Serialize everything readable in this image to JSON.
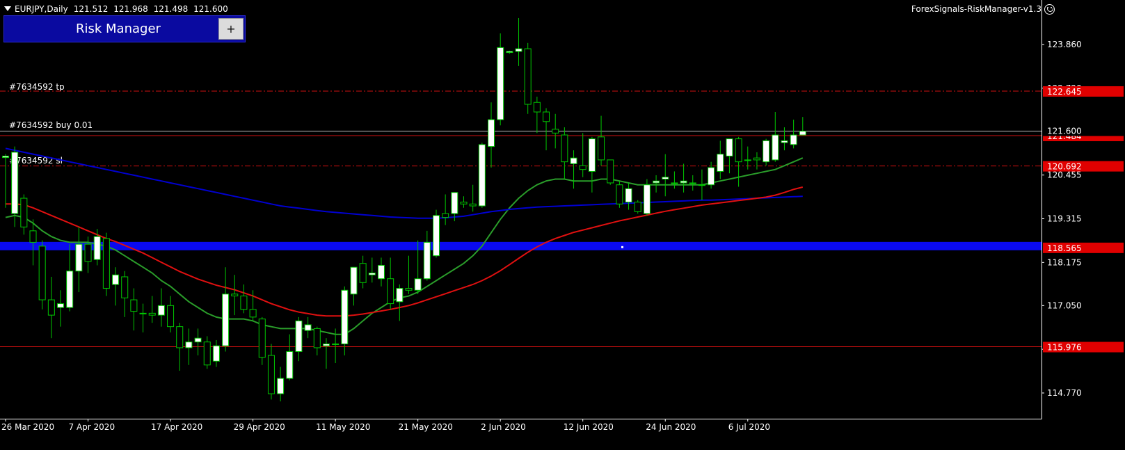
{
  "header": {
    "symbol": "EURJPY,Daily",
    "open": "121.512",
    "high": "121.968",
    "low": "121.498",
    "close": "121.600",
    "ea_name": "ForexSignals-RiskManager-v1.3",
    "ea_icon": "smile-icon"
  },
  "risk_manager": {
    "title": "Risk Manager",
    "plus_label": "+"
  },
  "order_labels": {
    "tp": "#7634592 tp",
    "buy": "#7634592 buy 0.01",
    "sl": "#7634592 sl"
  },
  "colors": {
    "background": "#000000",
    "bull_candle": "#ffffff",
    "bear_candle": "#000000",
    "wick": "#00c800",
    "ma_fast": "#2a9d2a",
    "ma_mid": "#0000d0",
    "ma_slow": "#e01010",
    "level_line": "#d01010",
    "blue_band": "#0a0af0",
    "price_tag": "#e00000"
  },
  "chart_data": {
    "type": "candlestick",
    "symbol": "EURJPY",
    "timeframe": "Daily",
    "y_axis": {
      "range": [
        114.0,
        124.8
      ],
      "ticks": [
        "123.860",
        "122.720",
        "121.600",
        "120.455",
        "119.315",
        "118.175",
        "117.050",
        "115.910",
        "114.770"
      ]
    },
    "x_axis": {
      "ticks": [
        "26 Mar 2020",
        "7 Apr 2020",
        "17 Apr 2020",
        "29 Apr 2020",
        "11 May 2020",
        "21 May 2020",
        "2 Jun 2020",
        "12 Jun 2020",
        "24 Jun 2020",
        "6 Jul 2020"
      ]
    },
    "grid": false,
    "candles": [
      {
        "o": 120.91,
        "h": 121.0,
        "l": 119.6,
        "c": 120.95
      },
      {
        "o": 119.45,
        "h": 121.2,
        "l": 119.1,
        "c": 121.05
      },
      {
        "o": 119.85,
        "h": 119.95,
        "l": 118.9,
        "c": 119.1
      },
      {
        "o": 119.0,
        "h": 119.3,
        "l": 118.1,
        "c": 118.7
      },
      {
        "o": 118.6,
        "h": 118.75,
        "l": 116.95,
        "c": 117.2
      },
      {
        "o": 117.2,
        "h": 117.8,
        "l": 116.2,
        "c": 116.8
      },
      {
        "o": 117.0,
        "h": 117.45,
        "l": 116.5,
        "c": 117.1
      },
      {
        "o": 117.0,
        "h": 118.65,
        "l": 116.9,
        "c": 117.95
      },
      {
        "o": 117.95,
        "h": 119.1,
        "l": 117.4,
        "c": 118.65
      },
      {
        "o": 118.65,
        "h": 118.85,
        "l": 117.9,
        "c": 118.2
      },
      {
        "o": 118.25,
        "h": 119.05,
        "l": 118.1,
        "c": 118.85
      },
      {
        "o": 118.8,
        "h": 118.95,
        "l": 117.3,
        "c": 117.5
      },
      {
        "o": 117.6,
        "h": 118.05,
        "l": 117.05,
        "c": 117.85
      },
      {
        "o": 117.8,
        "h": 117.95,
        "l": 116.75,
        "c": 117.25
      },
      {
        "o": 117.2,
        "h": 117.5,
        "l": 116.4,
        "c": 116.9
      },
      {
        "o": 116.85,
        "h": 117.1,
        "l": 116.35,
        "c": 116.85
      },
      {
        "o": 116.85,
        "h": 117.3,
        "l": 116.6,
        "c": 116.8
      },
      {
        "o": 116.8,
        "h": 117.5,
        "l": 116.5,
        "c": 117.05
      },
      {
        "o": 117.05,
        "h": 117.3,
        "l": 116.35,
        "c": 116.5
      },
      {
        "o": 116.5,
        "h": 116.6,
        "l": 115.35,
        "c": 115.95
      },
      {
        "o": 115.95,
        "h": 116.45,
        "l": 115.5,
        "c": 116.1
      },
      {
        "o": 116.1,
        "h": 116.45,
        "l": 115.75,
        "c": 116.2
      },
      {
        "o": 116.1,
        "h": 116.25,
        "l": 115.4,
        "c": 115.5
      },
      {
        "o": 115.6,
        "h": 116.15,
        "l": 115.45,
        "c": 116.0
      },
      {
        "o": 116.0,
        "h": 118.05,
        "l": 115.85,
        "c": 117.35
      },
      {
        "o": 117.35,
        "h": 117.85,
        "l": 116.8,
        "c": 117.3
      },
      {
        "o": 117.3,
        "h": 117.6,
        "l": 116.85,
        "c": 116.95
      },
      {
        "o": 116.95,
        "h": 117.45,
        "l": 116.65,
        "c": 116.75
      },
      {
        "o": 116.7,
        "h": 116.75,
        "l": 115.5,
        "c": 115.7
      },
      {
        "o": 115.75,
        "h": 116.05,
        "l": 114.6,
        "c": 114.75
      },
      {
        "o": 114.75,
        "h": 115.45,
        "l": 114.55,
        "c": 115.15
      },
      {
        "o": 115.15,
        "h": 116.3,
        "l": 115.1,
        "c": 115.85
      },
      {
        "o": 115.85,
        "h": 116.75,
        "l": 115.6,
        "c": 116.65
      },
      {
        "o": 116.4,
        "h": 116.75,
        "l": 116.2,
        "c": 116.55
      },
      {
        "o": 116.45,
        "h": 116.5,
        "l": 115.75,
        "c": 115.95
      },
      {
        "o": 116.0,
        "h": 116.2,
        "l": 115.4,
        "c": 116.05
      },
      {
        "o": 116.05,
        "h": 116.45,
        "l": 115.55,
        "c": 116.05
      },
      {
        "o": 116.05,
        "h": 117.55,
        "l": 115.75,
        "c": 117.45
      },
      {
        "o": 117.35,
        "h": 118.05,
        "l": 117.05,
        "c": 118.05
      },
      {
        "o": 118.15,
        "h": 118.35,
        "l": 117.5,
        "c": 117.65
      },
      {
        "o": 117.85,
        "h": 118.3,
        "l": 117.65,
        "c": 117.9
      },
      {
        "o": 117.75,
        "h": 118.3,
        "l": 117.55,
        "c": 118.1
      },
      {
        "o": 117.75,
        "h": 118.3,
        "l": 116.95,
        "c": 117.1
      },
      {
        "o": 117.15,
        "h": 117.6,
        "l": 116.65,
        "c": 117.5
      },
      {
        "o": 117.5,
        "h": 118.35,
        "l": 117.35,
        "c": 117.45
      },
      {
        "o": 117.45,
        "h": 118.75,
        "l": 117.35,
        "c": 117.75
      },
      {
        "o": 117.75,
        "h": 119.0,
        "l": 117.7,
        "c": 118.7
      },
      {
        "o": 118.35,
        "h": 119.55,
        "l": 118.3,
        "c": 119.4
      },
      {
        "o": 119.45,
        "h": 119.95,
        "l": 119.15,
        "c": 119.35
      },
      {
        "o": 119.45,
        "h": 120.0,
        "l": 119.25,
        "c": 120.0
      },
      {
        "o": 119.75,
        "h": 119.9,
        "l": 119.6,
        "c": 119.7
      },
      {
        "o": 119.7,
        "h": 120.2,
        "l": 119.5,
        "c": 119.65
      },
      {
        "o": 119.65,
        "h": 121.3,
        "l": 119.6,
        "c": 121.25
      },
      {
        "o": 121.2,
        "h": 122.35,
        "l": 120.65,
        "c": 121.9
      },
      {
        "o": 121.9,
        "h": 124.15,
        "l": 121.75,
        "c": 123.78
      },
      {
        "o": 123.65,
        "h": 123.7,
        "l": 123.62,
        "c": 123.68
      },
      {
        "o": 123.68,
        "h": 124.55,
        "l": 123.3,
        "c": 123.75
      },
      {
        "o": 123.75,
        "h": 123.9,
        "l": 122.05,
        "c": 122.3
      },
      {
        "o": 122.35,
        "h": 122.5,
        "l": 121.55,
        "c": 122.1
      },
      {
        "o": 122.1,
        "h": 122.2,
        "l": 121.1,
        "c": 121.85
      },
      {
        "o": 121.65,
        "h": 122.05,
        "l": 121.15,
        "c": 121.55
      },
      {
        "o": 121.5,
        "h": 121.7,
        "l": 120.35,
        "c": 120.8
      },
      {
        "o": 120.75,
        "h": 121.1,
        "l": 120.1,
        "c": 120.9
      },
      {
        "o": 120.7,
        "h": 121.55,
        "l": 120.4,
        "c": 120.6
      },
      {
        "o": 120.55,
        "h": 121.45,
        "l": 120.0,
        "c": 121.4
      },
      {
        "o": 121.45,
        "h": 122.0,
        "l": 120.7,
        "c": 120.85
      },
      {
        "o": 120.85,
        "h": 120.85,
        "l": 120.2,
        "c": 120.25
      },
      {
        "o": 120.2,
        "h": 120.3,
        "l": 119.6,
        "c": 119.7
      },
      {
        "o": 119.75,
        "h": 120.25,
        "l": 119.55,
        "c": 120.1
      },
      {
        "o": 119.75,
        "h": 119.8,
        "l": 119.45,
        "c": 119.5
      },
      {
        "o": 119.45,
        "h": 120.35,
        "l": 119.4,
        "c": 120.2
      },
      {
        "o": 120.25,
        "h": 120.45,
        "l": 120.0,
        "c": 120.3
      },
      {
        "o": 120.35,
        "h": 121.0,
        "l": 119.9,
        "c": 120.4
      },
      {
        "o": 120.25,
        "h": 120.55,
        "l": 120.1,
        "c": 120.25
      },
      {
        "o": 120.25,
        "h": 120.75,
        "l": 120.0,
        "c": 120.3
      },
      {
        "o": 120.25,
        "h": 120.45,
        "l": 120.05,
        "c": 120.25
      },
      {
        "o": 120.2,
        "h": 120.6,
        "l": 119.8,
        "c": 120.2
      },
      {
        "o": 120.2,
        "h": 120.8,
        "l": 120.1,
        "c": 120.65
      },
      {
        "o": 120.55,
        "h": 121.35,
        "l": 120.35,
        "c": 121.0
      },
      {
        "o": 120.95,
        "h": 121.4,
        "l": 120.5,
        "c": 121.4
      },
      {
        "o": 121.4,
        "h": 121.45,
        "l": 120.15,
        "c": 120.8
      },
      {
        "o": 120.85,
        "h": 121.2,
        "l": 120.6,
        "c": 120.85
      },
      {
        "o": 120.9,
        "h": 121.05,
        "l": 120.6,
        "c": 120.85
      },
      {
        "o": 120.8,
        "h": 121.4,
        "l": 120.7,
        "c": 121.35
      },
      {
        "o": 120.85,
        "h": 122.1,
        "l": 120.8,
        "c": 121.5
      },
      {
        "o": 121.3,
        "h": 121.7,
        "l": 121.1,
        "c": 121.35
      },
      {
        "o": 121.25,
        "h": 121.9,
        "l": 121.15,
        "c": 121.5
      },
      {
        "o": 121.5,
        "h": 121.97,
        "l": 121.49,
        "c": 121.6
      }
    ],
    "moving_averages": [
      {
        "color": "green",
        "values": [
          119.35,
          119.4,
          119.35,
          119.2,
          119.0,
          118.85,
          118.75,
          118.7,
          118.7,
          118.7,
          118.65,
          118.6,
          118.5,
          118.35,
          118.2,
          118.05,
          117.9,
          117.7,
          117.55,
          117.35,
          117.15,
          117.0,
          116.85,
          116.75,
          116.7,
          116.7,
          116.7,
          116.65,
          116.55,
          116.5,
          116.45,
          116.45,
          116.45,
          116.45,
          116.4,
          116.35,
          116.3,
          116.3,
          116.45,
          116.65,
          116.85,
          117.0,
          117.15,
          117.25,
          117.3,
          117.4,
          117.55,
          117.7,
          117.85,
          118.0,
          118.15,
          118.35,
          118.6,
          118.95,
          119.3,
          119.6,
          119.85,
          120.05,
          120.2,
          120.3,
          120.35,
          120.35,
          120.3,
          120.3,
          120.3,
          120.35,
          120.35,
          120.3,
          120.25,
          120.2,
          120.2,
          120.2,
          120.2,
          120.2,
          120.2,
          120.2,
          120.2,
          120.25,
          120.3,
          120.35,
          120.4,
          120.45,
          120.5,
          120.55,
          120.6,
          120.7,
          120.8,
          120.9
        ]
      },
      {
        "color": "blue",
        "values": [
          121.15,
          121.1,
          121.05,
          121.0,
          120.95,
          120.9,
          120.85,
          120.8,
          120.75,
          120.7,
          120.65,
          120.6,
          120.55,
          120.5,
          120.45,
          120.4,
          120.35,
          120.3,
          120.25,
          120.2,
          120.15,
          120.1,
          120.05,
          120.0,
          119.95,
          119.9,
          119.85,
          119.8,
          119.75,
          119.7,
          119.65,
          119.62,
          119.59,
          119.56,
          119.53,
          119.5,
          119.48,
          119.46,
          119.44,
          119.42,
          119.4,
          119.38,
          119.36,
          119.35,
          119.34,
          119.33,
          119.33,
          119.33,
          119.34,
          119.36,
          119.38,
          119.42,
          119.46,
          119.5,
          119.53,
          119.56,
          119.58,
          119.6,
          119.62,
          119.63,
          119.64,
          119.65,
          119.66,
          119.67,
          119.68,
          119.69,
          119.7,
          119.71,
          119.72,
          119.73,
          119.74,
          119.75,
          119.76,
          119.77,
          119.78,
          119.79,
          119.8,
          119.8,
          119.81,
          119.82,
          119.83,
          119.84,
          119.85,
          119.86,
          119.87,
          119.88,
          119.89,
          119.9
        ]
      },
      {
        "color": "red",
        "values": [
          119.7,
          119.7,
          119.68,
          119.6,
          119.5,
          119.4,
          119.3,
          119.2,
          119.1,
          119.0,
          118.9,
          118.8,
          118.72,
          118.62,
          118.52,
          118.42,
          118.3,
          118.18,
          118.06,
          117.94,
          117.84,
          117.74,
          117.66,
          117.58,
          117.52,
          117.46,
          117.38,
          117.3,
          117.2,
          117.1,
          117.02,
          116.94,
          116.88,
          116.84,
          116.8,
          116.78,
          116.78,
          116.78,
          116.8,
          116.83,
          116.87,
          116.91,
          116.95,
          117.0,
          117.05,
          117.12,
          117.2,
          117.28,
          117.36,
          117.44,
          117.52,
          117.6,
          117.7,
          117.82,
          117.96,
          118.12,
          118.28,
          118.44,
          118.58,
          118.7,
          118.8,
          118.88,
          118.96,
          119.02,
          119.08,
          119.14,
          119.2,
          119.26,
          119.31,
          119.36,
          119.41,
          119.46,
          119.51,
          119.55,
          119.59,
          119.63,
          119.67,
          119.7,
          119.73,
          119.76,
          119.79,
          119.82,
          119.85,
          119.88,
          119.93,
          120.0,
          120.08,
          120.14
        ]
      }
    ],
    "levels": [
      {
        "price": 122.645,
        "label": "122.645",
        "style": "dashdot",
        "kind": "tp"
      },
      {
        "price": 121.484,
        "label": "121.484",
        "style": "solid",
        "kind": "entry"
      },
      {
        "price": 121.6,
        "label": "121.600",
        "style": "solid",
        "kind": "bid"
      },
      {
        "price": 120.692,
        "label": "120.692",
        "style": "dashdot",
        "kind": "sl"
      },
      {
        "price": 118.565,
        "label": "118.565",
        "style": "band",
        "kind": "band"
      },
      {
        "price": 115.976,
        "label": "115.976",
        "style": "solid",
        "kind": "level"
      }
    ]
  }
}
